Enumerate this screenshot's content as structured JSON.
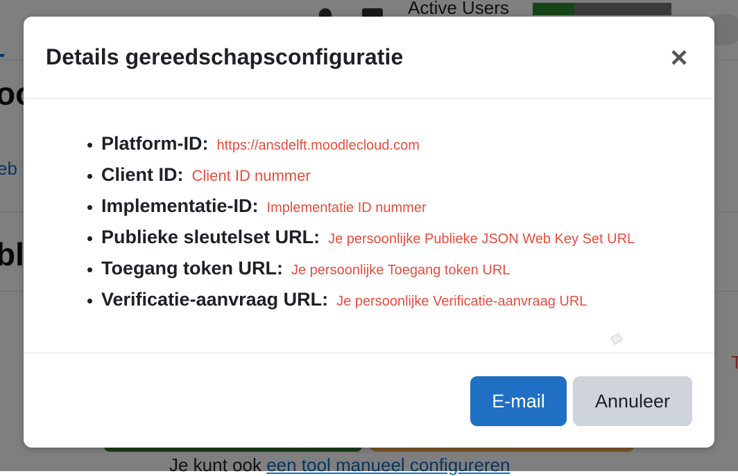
{
  "background": {
    "active_users_label": "Active Users",
    "active_users_fill_percent": 30,
    "bottom_text_prefix": "Je kunt ook ",
    "bottom_text_link": "een tool manueel configureren",
    "heading_fragment_1": "oo",
    "link_fragment": "eb",
    "heading_fragment_2": "bl",
    "red_fragment": "T"
  },
  "modal": {
    "title": "Details gereedschapsconfiguratie",
    "close_symbol": "×",
    "items": [
      {
        "label": "Platform-ID:",
        "value": "https://ansdelft.moodlecloud.com"
      },
      {
        "label": "Client ID:",
        "value": "Client ID nummer"
      },
      {
        "label": "Implementatie-ID:",
        "value": "Implementatie ID nummer"
      },
      {
        "label": "Publieke sleutelset URL:",
        "value": "Je persoonlijke Publieke JSON Web Key Set URL"
      },
      {
        "label": "Toegang token URL:",
        "value": "Je persoonlijke Toegang token URL"
      },
      {
        "label": "Verificatie-aanvraag URL:",
        "value": "Je persoonlijke Verificatie-aanvraag URL"
      }
    ],
    "buttons": {
      "email": "E-mail",
      "cancel": "Annuleer"
    }
  },
  "colors": {
    "primary": "#1f6fc5",
    "secondary": "#ced4da",
    "value_text": "#e74c3c",
    "overlay": "rgba(0,0,0,0.5)"
  },
  "icons": [
    "close-icon",
    "bell-icon",
    "chat-icon",
    "avatar"
  ]
}
